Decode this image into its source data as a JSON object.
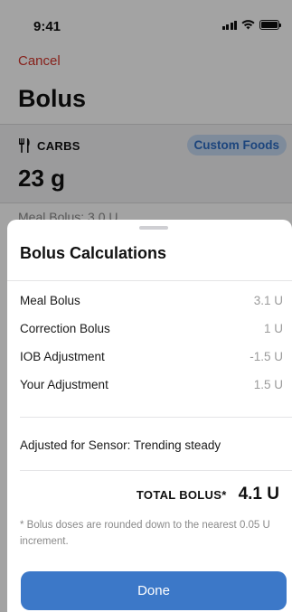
{
  "status": {
    "time": "9:41"
  },
  "nav": {
    "cancel_label": "Cancel",
    "title": "Bolus"
  },
  "carbs": {
    "label": "CARBS",
    "custom_foods_label": "Custom Foods",
    "value": "23 g"
  },
  "meal_bolus_peek": "Meal Bolus: 3.0 U",
  "sheet": {
    "title": "Bolus Calculations",
    "rows": [
      {
        "label": "Meal Bolus",
        "value": "3.1 U"
      },
      {
        "label": "Correction Bolus",
        "value": "1 U"
      },
      {
        "label": "IOB Adjustment",
        "value": "-1.5 U"
      },
      {
        "label": "Your Adjustment",
        "value": "1.5 U"
      }
    ],
    "sensor_text": "Adjusted for Sensor: Trending steady",
    "total_label": "TOTAL BOLUS*",
    "total_value": "4.1 U",
    "footnote": "* Bolus doses are rounded down to the nearest 0.05 U increment.",
    "done_label": "Done"
  },
  "colors": {
    "accent": "#3c78c8",
    "cancel": "#d3362c",
    "chip_bg": "#c6daf2"
  },
  "icons": [
    "signal-icon",
    "wifi-icon",
    "battery-icon",
    "fork-knife-icon"
  ]
}
